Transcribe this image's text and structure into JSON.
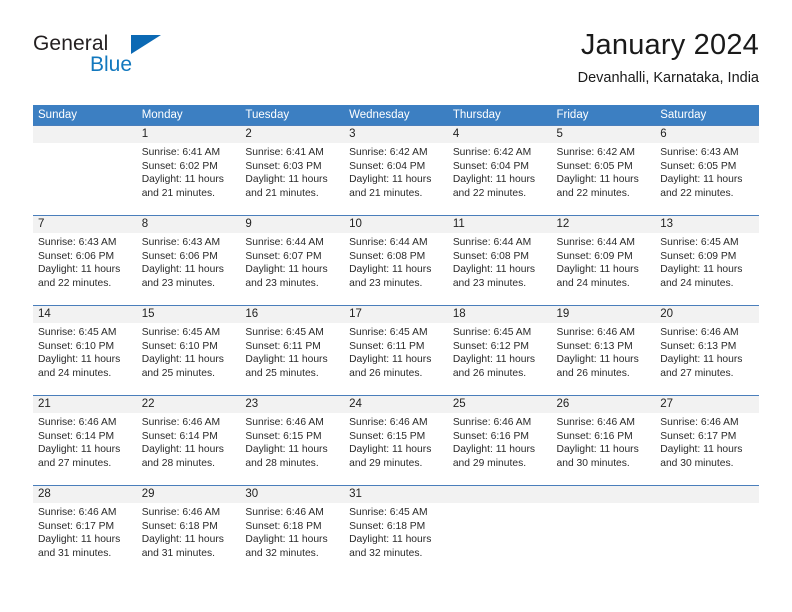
{
  "brand": {
    "word_one": "General",
    "word_two": "Blue",
    "triangle_icon": "blue-triangle-icon",
    "accent_color": "#1278be"
  },
  "header": {
    "title": "January 2024",
    "subtitle": "Devanhalli, Karnataka, India"
  },
  "calendar": {
    "header_bg": "#3c7fc2",
    "daynum_bg": "#f2f2f2",
    "separator_color": "#4a7ebb",
    "weekday_headers": [
      "Sunday",
      "Monday",
      "Tuesday",
      "Wednesday",
      "Thursday",
      "Friday",
      "Saturday"
    ],
    "weeks": [
      [
        {
          "day": "",
          "info": ""
        },
        {
          "day": "1",
          "info": "Sunrise: 6:41 AM\nSunset: 6:02 PM\nDaylight: 11 hours\nand 21 minutes."
        },
        {
          "day": "2",
          "info": "Sunrise: 6:41 AM\nSunset: 6:03 PM\nDaylight: 11 hours\nand 21 minutes."
        },
        {
          "day": "3",
          "info": "Sunrise: 6:42 AM\nSunset: 6:04 PM\nDaylight: 11 hours\nand 21 minutes."
        },
        {
          "day": "4",
          "info": "Sunrise: 6:42 AM\nSunset: 6:04 PM\nDaylight: 11 hours\nand 22 minutes."
        },
        {
          "day": "5",
          "info": "Sunrise: 6:42 AM\nSunset: 6:05 PM\nDaylight: 11 hours\nand 22 minutes."
        },
        {
          "day": "6",
          "info": "Sunrise: 6:43 AM\nSunset: 6:05 PM\nDaylight: 11 hours\nand 22 minutes."
        }
      ],
      [
        {
          "day": "7",
          "info": "Sunrise: 6:43 AM\nSunset: 6:06 PM\nDaylight: 11 hours\nand 22 minutes."
        },
        {
          "day": "8",
          "info": "Sunrise: 6:43 AM\nSunset: 6:06 PM\nDaylight: 11 hours\nand 23 minutes."
        },
        {
          "day": "9",
          "info": "Sunrise: 6:44 AM\nSunset: 6:07 PM\nDaylight: 11 hours\nand 23 minutes."
        },
        {
          "day": "10",
          "info": "Sunrise: 6:44 AM\nSunset: 6:08 PM\nDaylight: 11 hours\nand 23 minutes."
        },
        {
          "day": "11",
          "info": "Sunrise: 6:44 AM\nSunset: 6:08 PM\nDaylight: 11 hours\nand 23 minutes."
        },
        {
          "day": "12",
          "info": "Sunrise: 6:44 AM\nSunset: 6:09 PM\nDaylight: 11 hours\nand 24 minutes."
        },
        {
          "day": "13",
          "info": "Sunrise: 6:45 AM\nSunset: 6:09 PM\nDaylight: 11 hours\nand 24 minutes."
        }
      ],
      [
        {
          "day": "14",
          "info": "Sunrise: 6:45 AM\nSunset: 6:10 PM\nDaylight: 11 hours\nand 24 minutes."
        },
        {
          "day": "15",
          "info": "Sunrise: 6:45 AM\nSunset: 6:10 PM\nDaylight: 11 hours\nand 25 minutes."
        },
        {
          "day": "16",
          "info": "Sunrise: 6:45 AM\nSunset: 6:11 PM\nDaylight: 11 hours\nand 25 minutes."
        },
        {
          "day": "17",
          "info": "Sunrise: 6:45 AM\nSunset: 6:11 PM\nDaylight: 11 hours\nand 26 minutes."
        },
        {
          "day": "18",
          "info": "Sunrise: 6:45 AM\nSunset: 6:12 PM\nDaylight: 11 hours\nand 26 minutes."
        },
        {
          "day": "19",
          "info": "Sunrise: 6:46 AM\nSunset: 6:13 PM\nDaylight: 11 hours\nand 26 minutes."
        },
        {
          "day": "20",
          "info": "Sunrise: 6:46 AM\nSunset: 6:13 PM\nDaylight: 11 hours\nand 27 minutes."
        }
      ],
      [
        {
          "day": "21",
          "info": "Sunrise: 6:46 AM\nSunset: 6:14 PM\nDaylight: 11 hours\nand 27 minutes."
        },
        {
          "day": "22",
          "info": "Sunrise: 6:46 AM\nSunset: 6:14 PM\nDaylight: 11 hours\nand 28 minutes."
        },
        {
          "day": "23",
          "info": "Sunrise: 6:46 AM\nSunset: 6:15 PM\nDaylight: 11 hours\nand 28 minutes."
        },
        {
          "day": "24",
          "info": "Sunrise: 6:46 AM\nSunset: 6:15 PM\nDaylight: 11 hours\nand 29 minutes."
        },
        {
          "day": "25",
          "info": "Sunrise: 6:46 AM\nSunset: 6:16 PM\nDaylight: 11 hours\nand 29 minutes."
        },
        {
          "day": "26",
          "info": "Sunrise: 6:46 AM\nSunset: 6:16 PM\nDaylight: 11 hours\nand 30 minutes."
        },
        {
          "day": "27",
          "info": "Sunrise: 6:46 AM\nSunset: 6:17 PM\nDaylight: 11 hours\nand 30 minutes."
        }
      ],
      [
        {
          "day": "28",
          "info": "Sunrise: 6:46 AM\nSunset: 6:17 PM\nDaylight: 11 hours\nand 31 minutes."
        },
        {
          "day": "29",
          "info": "Sunrise: 6:46 AM\nSunset: 6:18 PM\nDaylight: 11 hours\nand 31 minutes."
        },
        {
          "day": "30",
          "info": "Sunrise: 6:46 AM\nSunset: 6:18 PM\nDaylight: 11 hours\nand 32 minutes."
        },
        {
          "day": "31",
          "info": "Sunrise: 6:45 AM\nSunset: 6:18 PM\nDaylight: 11 hours\nand 32 minutes."
        },
        {
          "day": "",
          "info": ""
        },
        {
          "day": "",
          "info": ""
        },
        {
          "day": "",
          "info": ""
        }
      ]
    ]
  }
}
